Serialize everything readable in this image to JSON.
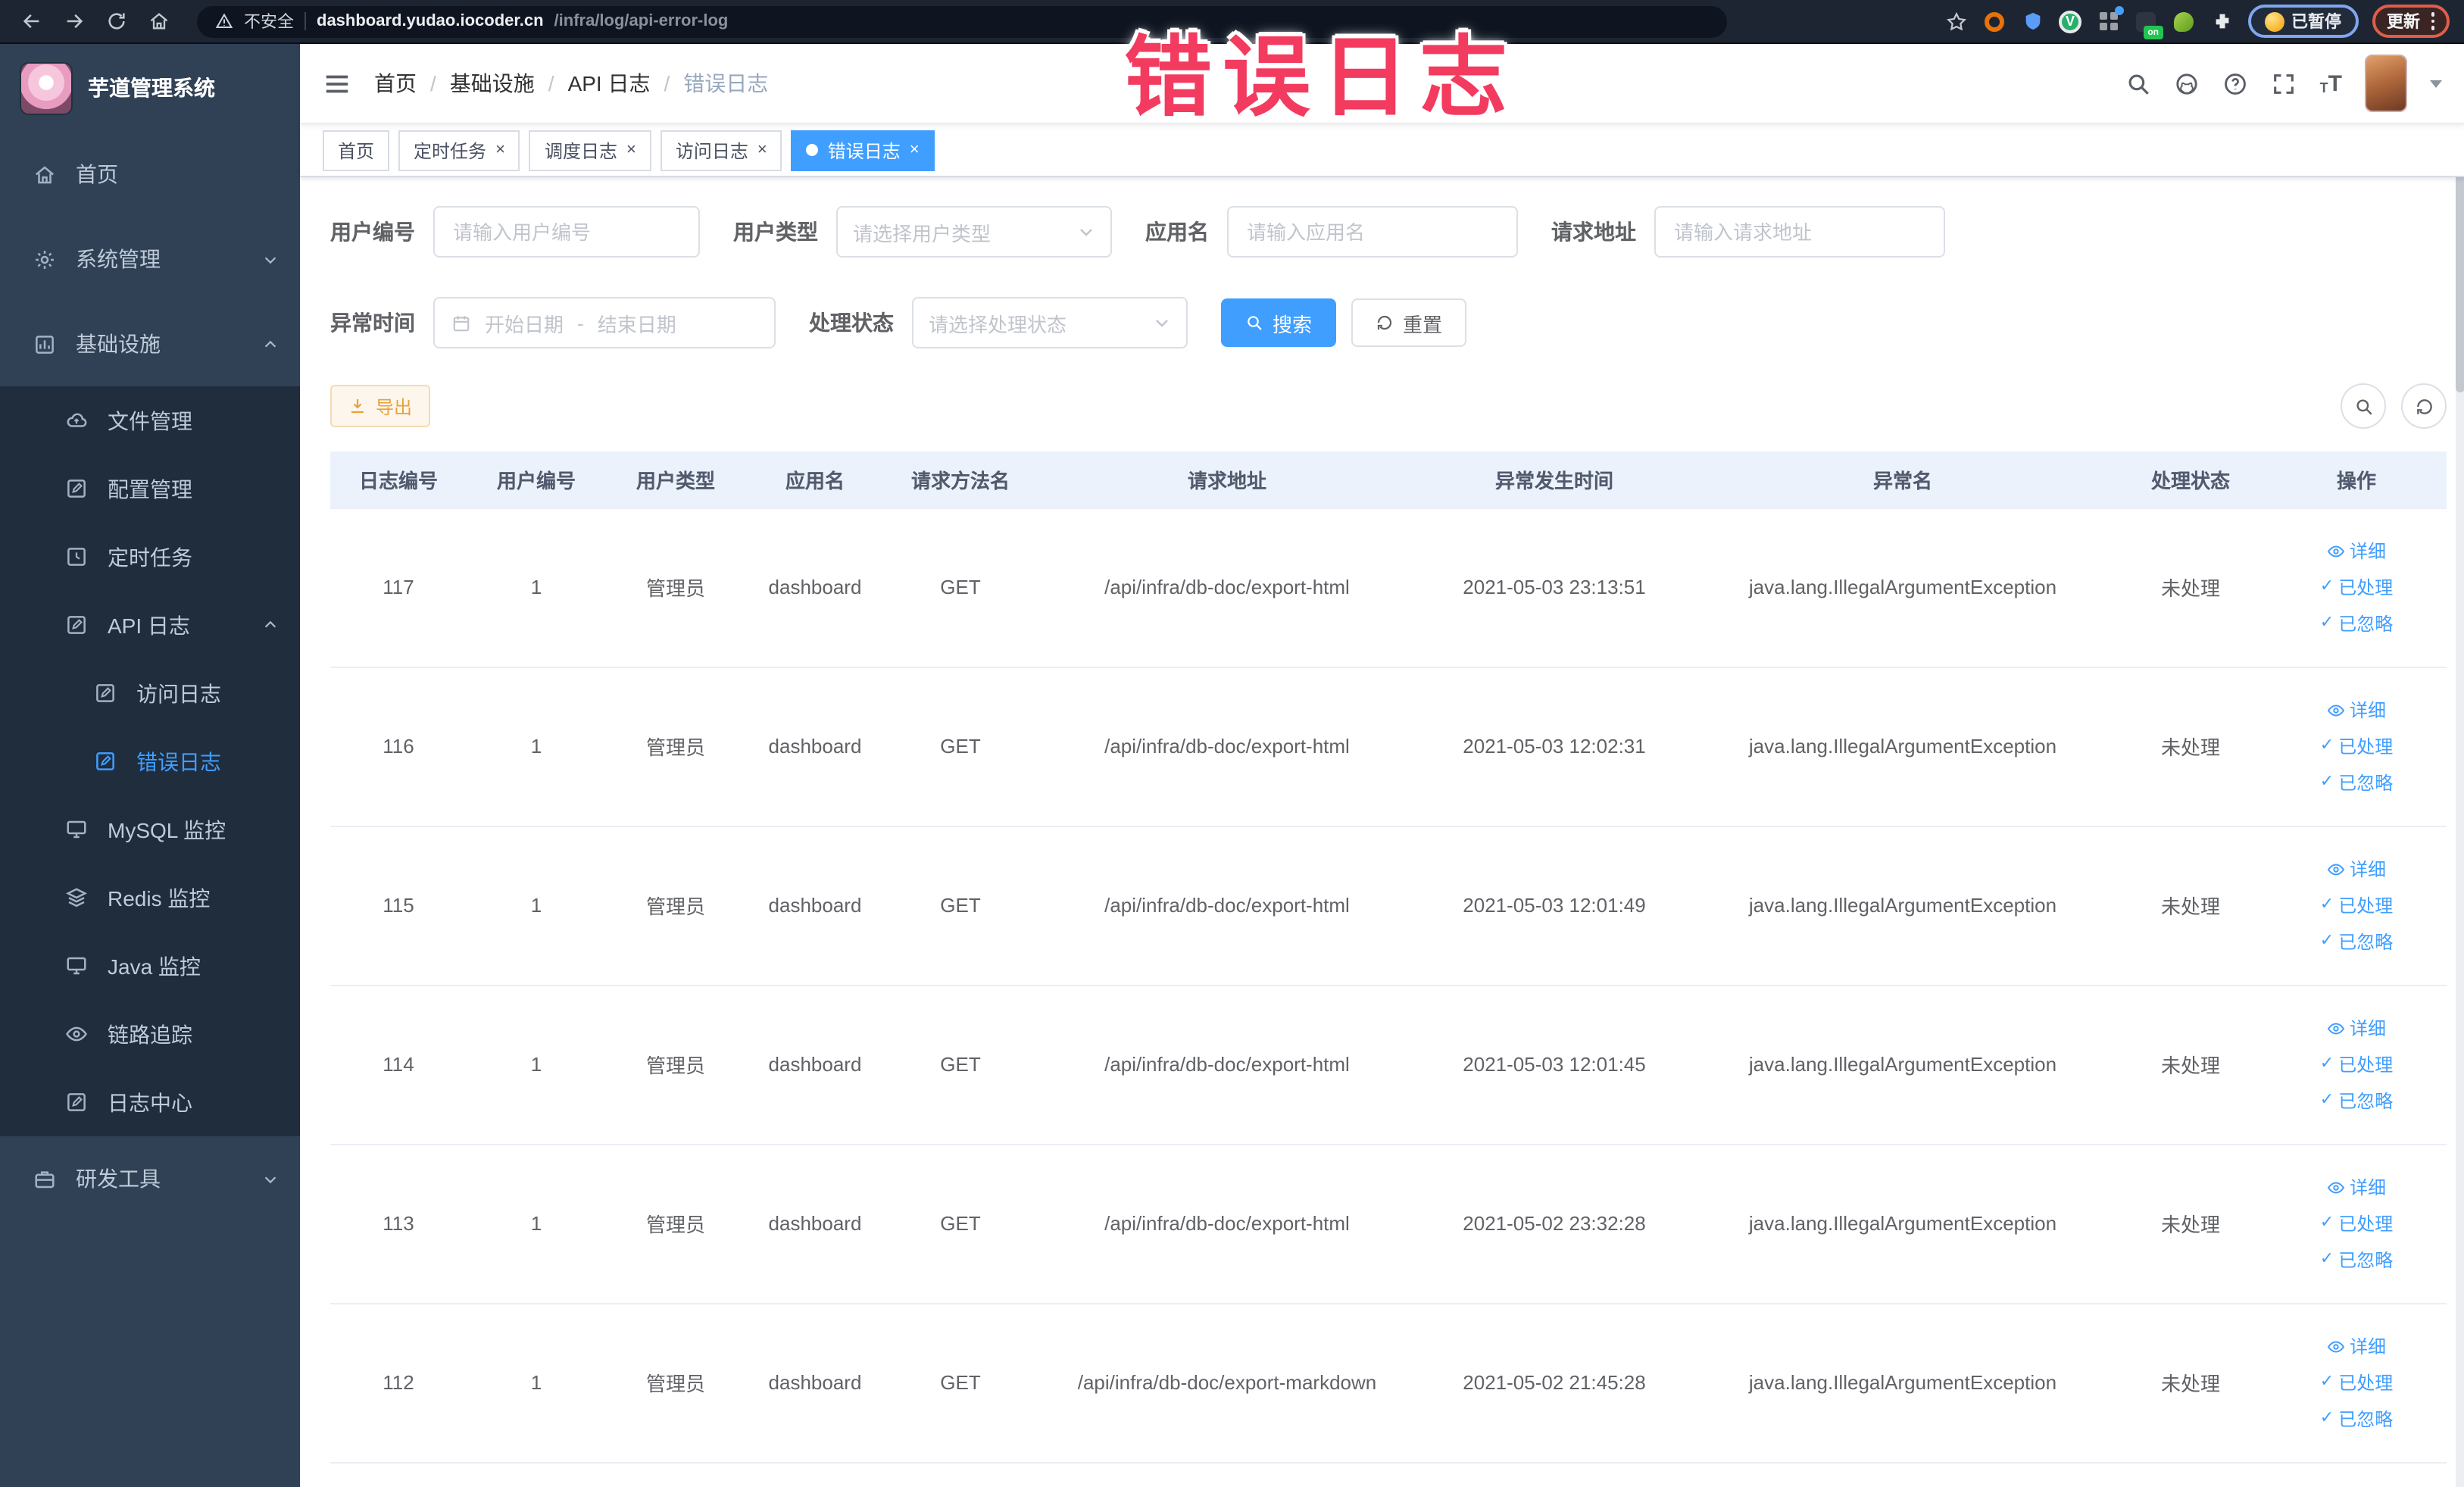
{
  "annotation": {
    "text": "错误日志"
  },
  "browser": {
    "security_label": "不安全",
    "url_host": "dashboard.yudao.iocoder.cn",
    "url_path": "/infra/log/api-error-log",
    "on_badge_label": "on",
    "paused_label": "已暂停",
    "update_label": "更新"
  },
  "sidebar": {
    "title": "芋道管理系统",
    "items": [
      {
        "label": "首页"
      },
      {
        "label": "系统管理"
      },
      {
        "label": "基础设施"
      },
      {
        "label": "文件管理"
      },
      {
        "label": "配置管理"
      },
      {
        "label": "定时任务"
      },
      {
        "label": "API 日志"
      },
      {
        "label": "访问日志"
      },
      {
        "label": "错误日志"
      },
      {
        "label": "MySQL 监控"
      },
      {
        "label": "Redis 监控"
      },
      {
        "label": "Java 监控"
      },
      {
        "label": "链路追踪"
      },
      {
        "label": "日志中心"
      },
      {
        "label": "研发工具"
      }
    ]
  },
  "breadcrumb": {
    "items": [
      "首页",
      "基础设施",
      "API 日志",
      "错误日志"
    ]
  },
  "tags": [
    {
      "label": "首页"
    },
    {
      "label": "定时任务"
    },
    {
      "label": "调度日志"
    },
    {
      "label": "访问日志"
    },
    {
      "label": "错误日志"
    }
  ],
  "filters": {
    "user_id": {
      "label": "用户编号",
      "placeholder": "请输入用户编号"
    },
    "user_type": {
      "label": "用户类型",
      "placeholder": "请选择用户类型"
    },
    "app_name": {
      "label": "应用名",
      "placeholder": "请输入应用名"
    },
    "request_url": {
      "label": "请求地址",
      "placeholder": "请输入请求地址"
    },
    "exception_time": {
      "label": "异常时间",
      "start_placeholder": "开始日期",
      "separator": "-",
      "end_placeholder": "结束日期"
    },
    "process_status": {
      "label": "处理状态",
      "placeholder": "请选择处理状态"
    },
    "search_label": "搜索",
    "reset_label": "重置"
  },
  "toolbar": {
    "export_label": "导出"
  },
  "table": {
    "columns": [
      "日志编号",
      "用户编号",
      "用户类型",
      "应用名",
      "请求方法名",
      "请求地址",
      "异常发生时间",
      "异常名",
      "处理状态",
      "操作"
    ],
    "actions": {
      "detail": "详细",
      "process": "已处理",
      "ignore": "已忽略"
    },
    "rows": [
      {
        "id": "117",
        "user_id": "1",
        "user_type": "管理员",
        "app": "dashboard",
        "method": "GET",
        "url": "/api/infra/db-doc/export-html",
        "time": "2021-05-03 23:13:51",
        "exception": "java.lang.IllegalArgumentException",
        "status": "未处理"
      },
      {
        "id": "116",
        "user_id": "1",
        "user_type": "管理员",
        "app": "dashboard",
        "method": "GET",
        "url": "/api/infra/db-doc/export-html",
        "time": "2021-05-03 12:02:31",
        "exception": "java.lang.IllegalArgumentException",
        "status": "未处理"
      },
      {
        "id": "115",
        "user_id": "1",
        "user_type": "管理员",
        "app": "dashboard",
        "method": "GET",
        "url": "/api/infra/db-doc/export-html",
        "time": "2021-05-03 12:01:49",
        "exception": "java.lang.IllegalArgumentException",
        "status": "未处理"
      },
      {
        "id": "114",
        "user_id": "1",
        "user_type": "管理员",
        "app": "dashboard",
        "method": "GET",
        "url": "/api/infra/db-doc/export-html",
        "time": "2021-05-03 12:01:45",
        "exception": "java.lang.IllegalArgumentException",
        "status": "未处理"
      },
      {
        "id": "113",
        "user_id": "1",
        "user_type": "管理员",
        "app": "dashboard",
        "method": "GET",
        "url": "/api/infra/db-doc/export-html",
        "time": "2021-05-02 23:32:28",
        "exception": "java.lang.IllegalArgumentException",
        "status": "未处理"
      },
      {
        "id": "112",
        "user_id": "1",
        "user_type": "管理员",
        "app": "dashboard",
        "method": "GET",
        "url": "/api/infra/db-doc/export-markdown",
        "time": "2021-05-02 21:45:28",
        "exception": "java.lang.IllegalArgumentException",
        "status": "未处理"
      }
    ]
  },
  "icons": {
    "close": "×",
    "check": "✓"
  },
  "colors": {
    "primary": "#409EFF",
    "warning": "#E6A23C",
    "sidebar_bg": "#304156",
    "submenu_bg": "#1F2D3D",
    "table_header_bg": "#ECF2FB",
    "annotation": "#F23B5F"
  }
}
